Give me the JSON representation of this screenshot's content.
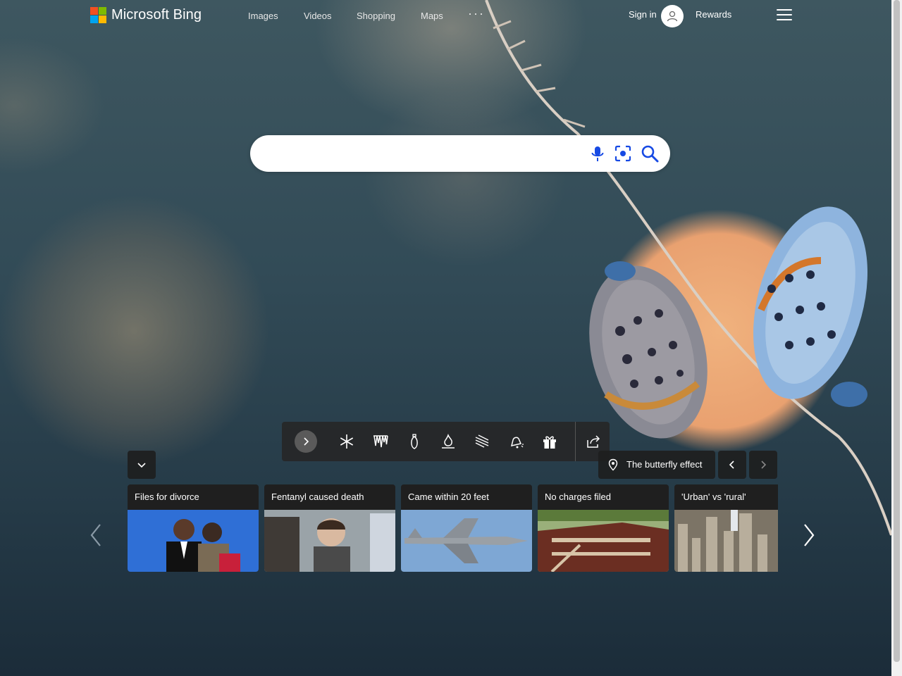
{
  "header": {
    "brand": "Microsoft Bing",
    "logo_colors": [
      "#f25022",
      "#7fba00",
      "#00a4ef",
      "#ffb900"
    ],
    "nav": [
      {
        "label": "Images"
      },
      {
        "label": "Videos"
      },
      {
        "label": "Shopping"
      },
      {
        "label": "Maps"
      }
    ],
    "more_label": "···",
    "sign_in_label": "Sign in",
    "avatar_icon": "person-icon",
    "rewards_label": "Rewards",
    "menu_icon": "hamburger-icon"
  },
  "search": {
    "value": "",
    "placeholder": "",
    "icons": [
      "microphone-icon",
      "visual-search-icon",
      "search-icon"
    ]
  },
  "toolbar": {
    "icons": [
      "next-chevron-icon",
      "snowflake-icon",
      "icicles-icon",
      "ornament-icon",
      "fire-icon",
      "wind-icon",
      "bell-icon",
      "gift-icon",
      "share-icon"
    ]
  },
  "image_caption": {
    "label": "The butterfly effect",
    "icon": "location-pin-icon"
  },
  "news": [
    {
      "title": "Files for divorce"
    },
    {
      "title": "Fentanyl caused death"
    },
    {
      "title": "Came within 20 feet"
    },
    {
      "title": "No charges filed"
    },
    {
      "title": "'Urban' vs 'rural'"
    }
  ]
}
